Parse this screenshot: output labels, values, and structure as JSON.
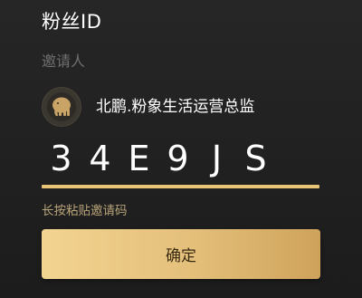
{
  "header": {
    "title": "粉丝ID"
  },
  "inviter": {
    "label": "邀请人",
    "name": "北鹏.粉象生活运营总监",
    "avatar_icon": "elephant-logo-icon"
  },
  "invite_code": {
    "chars": [
      "3",
      "4",
      "E",
      "9",
      "J",
      "S"
    ],
    "underline_color": "#e8c476"
  },
  "actions": {
    "paste_label": "长按粘贴邀请码",
    "confirm_label": "确定",
    "confirm_color": "#e6c27c"
  }
}
